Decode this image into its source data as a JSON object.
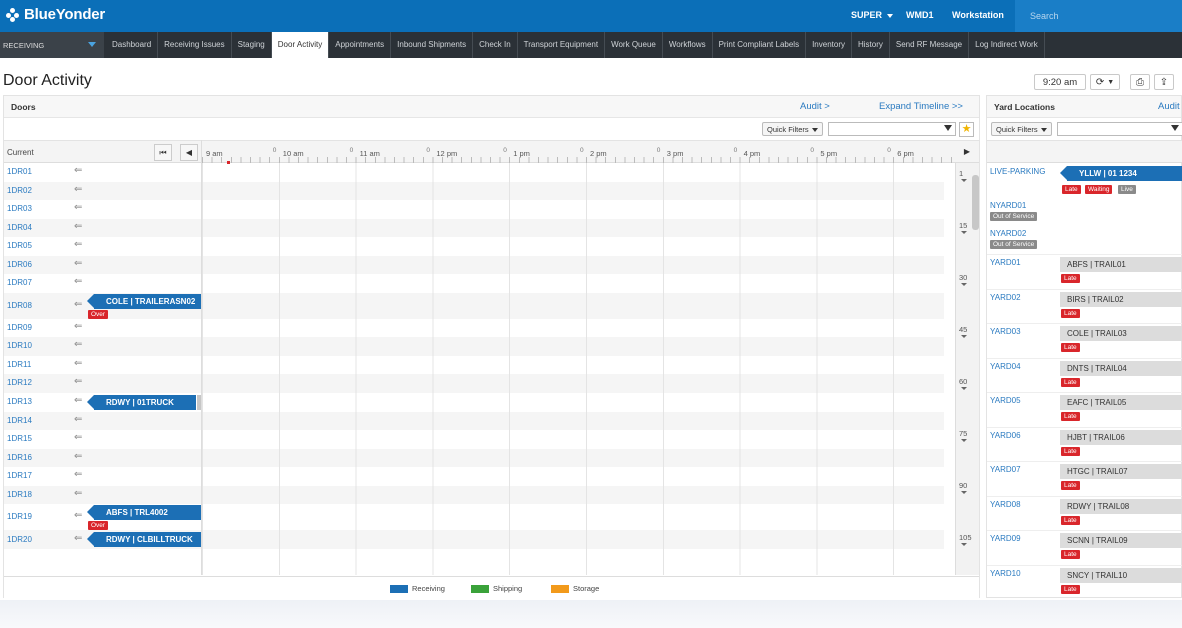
{
  "brand": {
    "name": "BlueYonder"
  },
  "top_links": {
    "user": "SUPER",
    "warehouse": "WMD1",
    "workstation": "Workstation"
  },
  "search": {
    "placeholder": "Search"
  },
  "module_select": {
    "value": "RECEIVING"
  },
  "tabs": [
    {
      "label": "Dashboard"
    },
    {
      "label": "Receiving Issues"
    },
    {
      "label": "Staging"
    },
    {
      "label": "Door Activity"
    },
    {
      "label": "Appointments"
    },
    {
      "label": "Inbound Shipments"
    },
    {
      "label": "Check In"
    },
    {
      "label": "Transport Equipment"
    },
    {
      "label": "Work Queue"
    },
    {
      "label": "Workflows"
    },
    {
      "label": "Print Compliant Labels"
    },
    {
      "label": "Inventory"
    },
    {
      "label": "History"
    },
    {
      "label": "Send RF Message"
    },
    {
      "label": "Log Indirect Work"
    }
  ],
  "page": {
    "title": "Door Activity",
    "time": "9:20 am"
  },
  "doors": {
    "title": "Doors",
    "audit_link": "Audit >",
    "expand_link": "Expand Timeline >>",
    "quick_filters": "Quick Filters",
    "current_label": "Current",
    "times": [
      "9 am",
      "10 am",
      "11 am",
      "12 pm",
      "1 pm",
      "2 pm",
      "3 pm",
      "4 pm",
      "5 pm",
      "6 pm"
    ],
    "scroll_marks": [
      "1",
      "15",
      "30",
      "45",
      "60",
      "75",
      "90",
      "105"
    ],
    "rows": [
      {
        "door": "1DR01"
      },
      {
        "door": "1DR02"
      },
      {
        "door": "1DR03"
      },
      {
        "door": "1DR04"
      },
      {
        "door": "1DR05"
      },
      {
        "door": "1DR06"
      },
      {
        "door": "1DR07"
      },
      {
        "door": "1DR08",
        "trailer": "COLE | TRAILERASN02",
        "badge": "Over"
      },
      {
        "door": "1DR09"
      },
      {
        "door": "1DR10"
      },
      {
        "door": "1DR11"
      },
      {
        "door": "1DR12"
      },
      {
        "door": "1DR13",
        "trailer": "RDWY | 01TRUCK"
      },
      {
        "door": "1DR14"
      },
      {
        "door": "1DR15"
      },
      {
        "door": "1DR16"
      },
      {
        "door": "1DR17"
      },
      {
        "door": "1DR18"
      },
      {
        "door": "1DR19",
        "trailer": "ABFS | TRL4002",
        "badge": "Over"
      },
      {
        "door": "1DR20",
        "trailer": "RDWY | CLBILLTRUCK"
      }
    ],
    "legend": [
      {
        "label": "Receiving",
        "color": "#1c6fb5"
      },
      {
        "label": "Shipping",
        "color": "#3aa23a"
      },
      {
        "label": "Storage",
        "color": "#f29a1b"
      }
    ]
  },
  "yard": {
    "title": "Yard Locations",
    "audit_link": "Audit",
    "quick_filters": "Quick Filters",
    "live_parking": {
      "name": "LIVE-PARKING",
      "trailer": "YLLW | 01 1234",
      "badges": [
        "Late",
        "Waiting",
        "Live"
      ]
    },
    "out_of_service": [
      {
        "name": "NYARD01",
        "status": "Out of Service"
      },
      {
        "name": "NYARD02",
        "status": "Out of Service"
      }
    ],
    "locations": [
      {
        "name": "YARD01",
        "trailer": "ABFS | TRAIL01",
        "badge": "Late"
      },
      {
        "name": "YARD02",
        "trailer": "BIRS | TRAIL02",
        "badge": "Late"
      },
      {
        "name": "YARD03",
        "trailer": "COLE | TRAIL03",
        "badge": "Late"
      },
      {
        "name": "YARD04",
        "trailer": "DNTS | TRAIL04",
        "badge": "Late"
      },
      {
        "name": "YARD05",
        "trailer": "EAFC | TRAIL05",
        "badge": "Late"
      },
      {
        "name": "YARD06",
        "trailer": "HJBT | TRAIL06",
        "badge": "Late"
      },
      {
        "name": "YARD07",
        "trailer": "HTGC | TRAIL07",
        "badge": "Late"
      },
      {
        "name": "YARD08",
        "trailer": "RDWY | TRAIL08",
        "badge": "Late"
      },
      {
        "name": "YARD09",
        "trailer": "SCNN | TRAIL09",
        "badge": "Late"
      },
      {
        "name": "YARD10",
        "trailer": "SNCY | TRAIL10",
        "badge": "Late"
      }
    ]
  }
}
